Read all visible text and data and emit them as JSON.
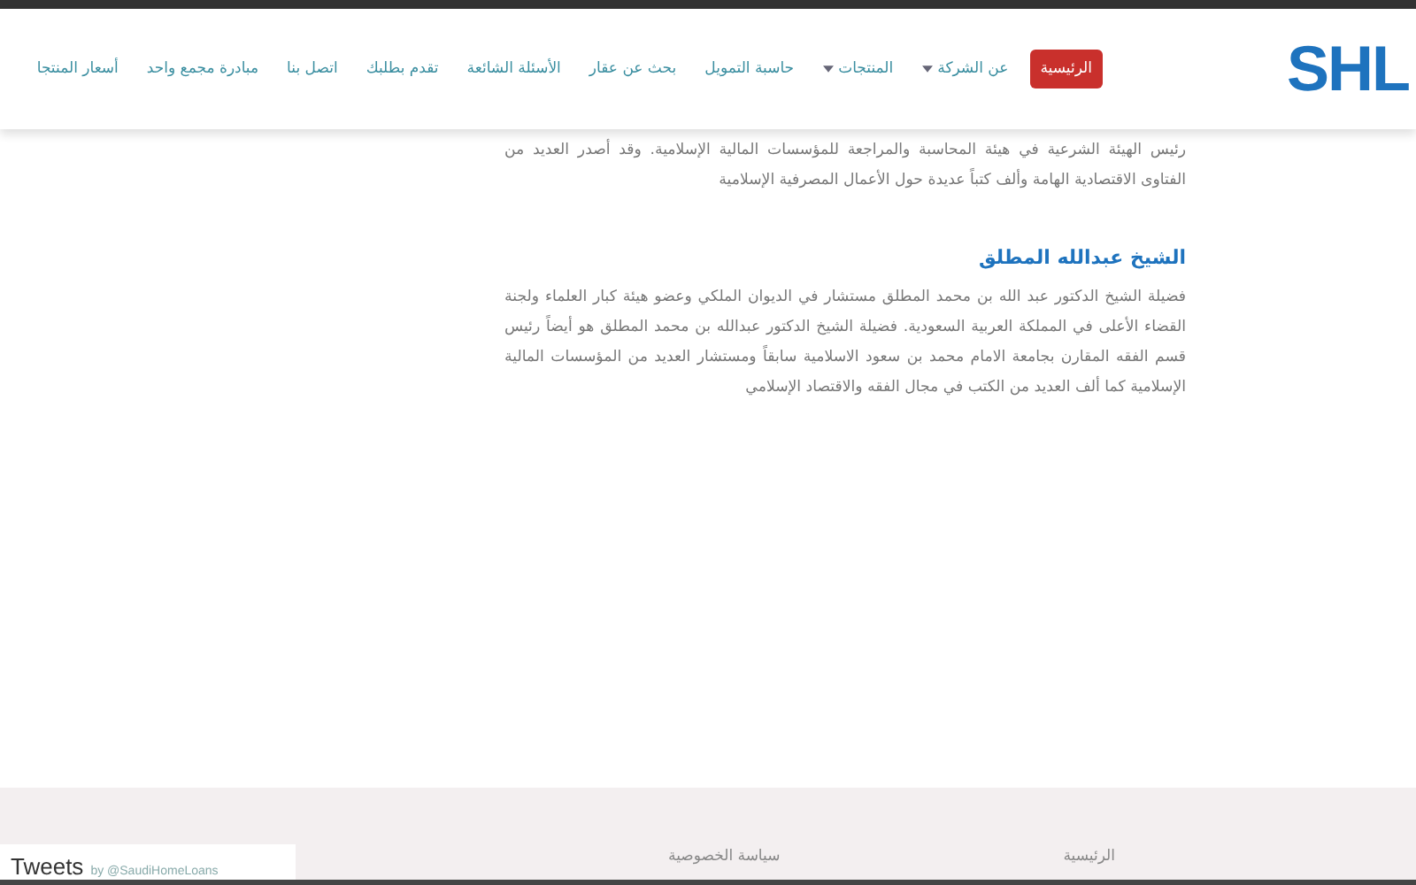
{
  "header": {
    "logo": "SHL",
    "nav": [
      {
        "label": "الرئيسية",
        "selected": true,
        "dropdown": false
      },
      {
        "label": "عن الشركة",
        "selected": false,
        "dropdown": true
      },
      {
        "label": "المنتجات",
        "selected": false,
        "dropdown": true
      },
      {
        "label": "حاسبة التمويل",
        "selected": false,
        "dropdown": false
      },
      {
        "label": "بحث عن عقار",
        "selected": false,
        "dropdown": false
      },
      {
        "label": "الأسئلة الشائعة",
        "selected": false,
        "dropdown": false
      },
      {
        "label": "تقدم بطلبك",
        "selected": false,
        "dropdown": false
      },
      {
        "label": "اتصل بنا",
        "selected": false,
        "dropdown": false
      },
      {
        "label": "مبادرة مجمع واحد",
        "selected": false,
        "dropdown": false
      },
      {
        "label": "أسعار المنتجا",
        "selected": false,
        "dropdown": false
      }
    ]
  },
  "content": {
    "sections": [
      {
        "text": "رئيس الهيئة الشرعية في هيئة المحاسبة والمراجعة للمؤسسات المالية الإسلامية. وقد أصدر العديد من الفتاوى الاقتصادية الهامة وألف كتباً عديدة حول الأعمال المصرفية الإسلامية"
      },
      {
        "heading": "الشيخ عبدالله المطلق",
        "text": "فضيلة الشيخ الدكتور عبد الله بن محمد المطلق مستشار في الديوان الملكي وعضو هيئة كبار العلماء ولجنة القضاء الأعلى في المملكة العربية السعودية. فضيلة الشيخ الدكتور عبدالله بن محمد المطلق هو أيضاً رئيس قسم الفقه المقارن بجامعة الامام محمد بن سعود الاسلامية سابقاً ومستشار العديد من المؤسسات المالية الإسلامية كما ألف العديد من الكتب في مجال الفقه والاقتصاد الإسلامي"
      }
    ]
  },
  "footer": {
    "links": [
      "الرئيسية",
      "سياسة الخصوصية"
    ],
    "tweets": {
      "title": "Tweets",
      "by": "by @SaudiHomeLoans"
    }
  }
}
